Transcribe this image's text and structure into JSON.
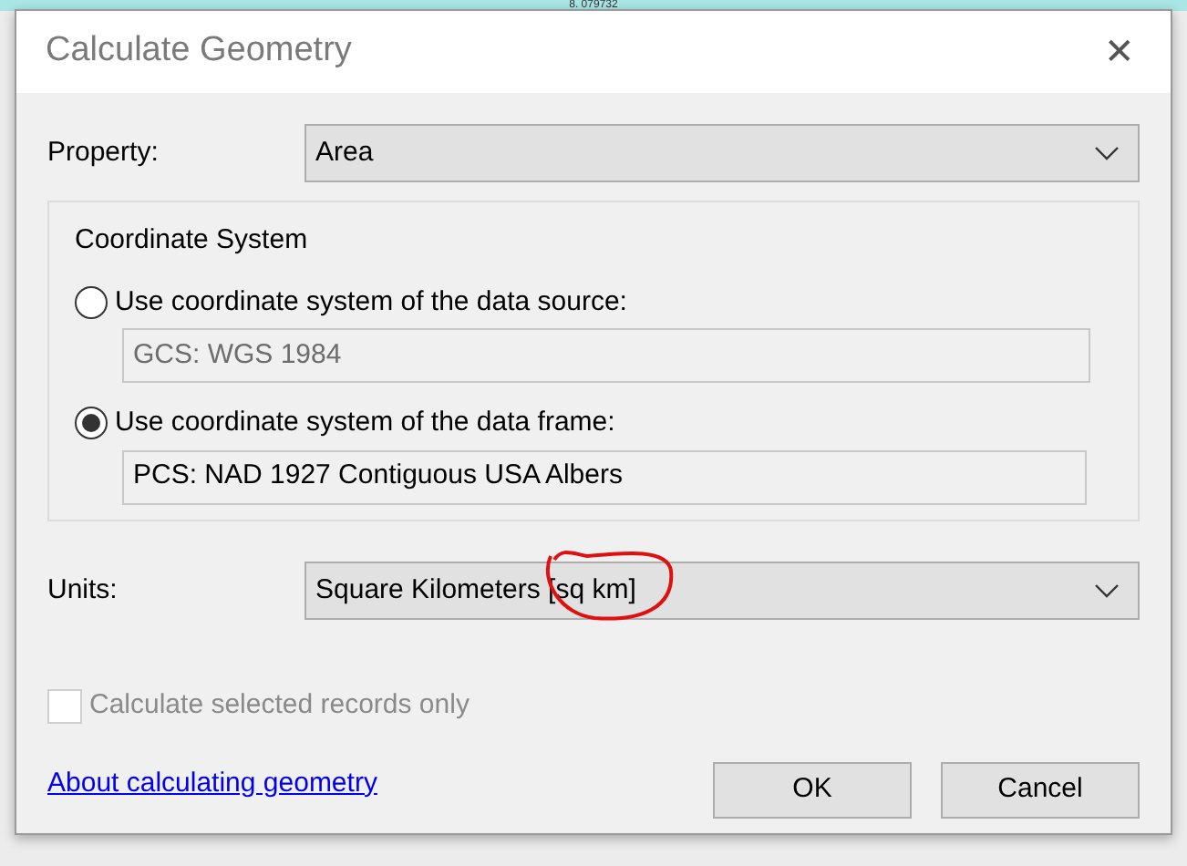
{
  "background": {
    "text": "8. 079732"
  },
  "window": {
    "title": "Calculate Geometry",
    "close": "✕"
  },
  "property": {
    "label": "Property:",
    "value": "Area"
  },
  "coordinate_system": {
    "legend": "Coordinate System",
    "options": [
      {
        "label": "Use coordinate system of the data source:",
        "selected": false,
        "value": "GCS: WGS 1984"
      },
      {
        "label": "Use coordinate system of the data frame:",
        "selected": true,
        "value": "PCS: NAD 1927 Contiguous USA Albers"
      }
    ]
  },
  "units": {
    "label": "Units:",
    "value": "Square Kilometers [sq km]"
  },
  "selected_only": {
    "label": "Calculate selected records only",
    "checked": false,
    "disabled": true
  },
  "link": "About calculating geometry",
  "buttons": [
    "OK",
    "Cancel"
  ]
}
